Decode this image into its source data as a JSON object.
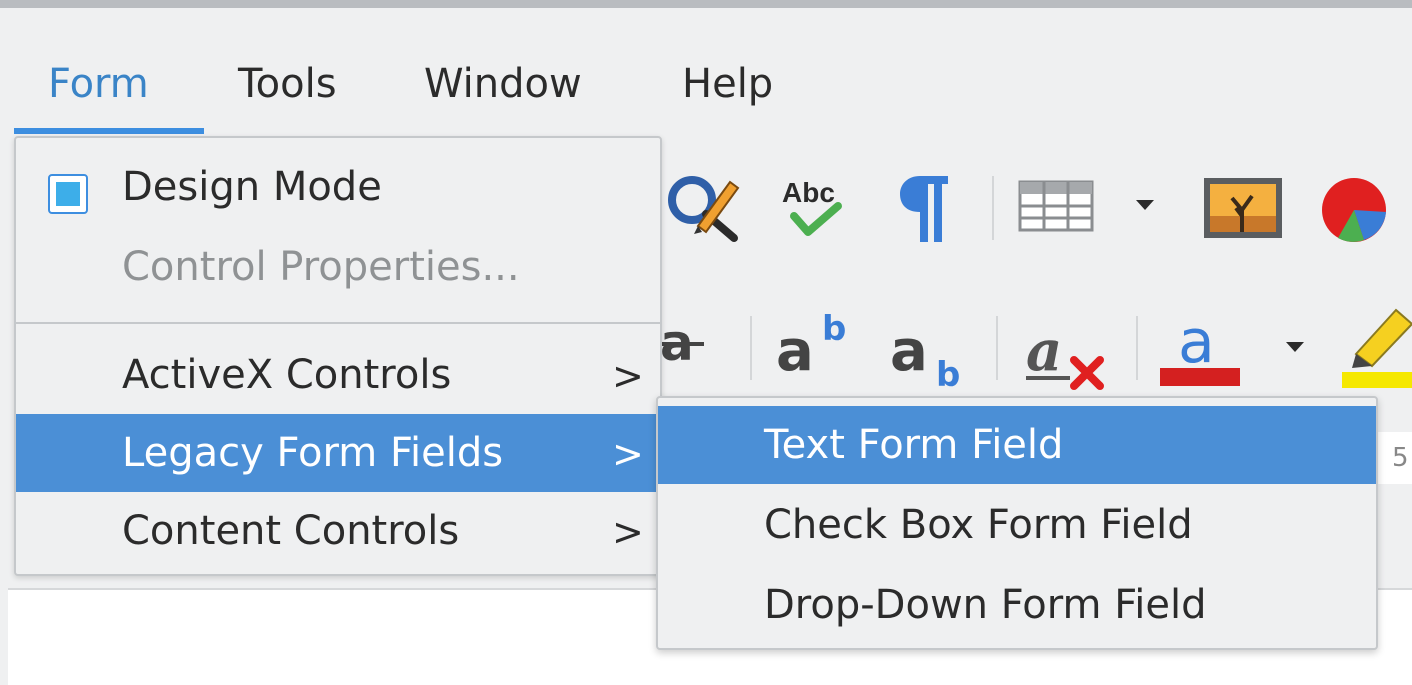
{
  "menubar": {
    "items": [
      {
        "label": "Form",
        "active": true
      },
      {
        "label": "Tools",
        "active": false
      },
      {
        "label": "Window",
        "active": false
      },
      {
        "label": "Help",
        "active": false
      }
    ]
  },
  "form_menu": {
    "items": [
      {
        "label": "Design Mode",
        "checked": true,
        "enabled": true
      },
      {
        "label": "Control Properties...",
        "enabled": false
      },
      {
        "label": "ActiveX Controls",
        "arrow": ">"
      },
      {
        "label": "Legacy Form Fields",
        "arrow": ">",
        "highlighted": true
      },
      {
        "label": "Content Controls",
        "arrow": ">"
      }
    ]
  },
  "submenu": {
    "items": [
      {
        "label": "Text Form Field",
        "highlighted": true
      },
      {
        "label": "Check Box Form Field"
      },
      {
        "label": "Drop-Down Form Field"
      }
    ]
  },
  "toolbar": {
    "spellcheck_text": "Abc",
    "superscript_base": "a",
    "superscript_exp": "b",
    "subscript_base": "a",
    "subscript_sub": "b",
    "clear_format_text": "a",
    "font_color_text": "a",
    "strikethrough_text": "a",
    "ruler_digit": "5"
  },
  "colors": {
    "accent": "#3d8ee0",
    "highlight": "#4b8fd6",
    "font_color_bar": "#d42020",
    "highlight_bar": "#f5e800"
  }
}
